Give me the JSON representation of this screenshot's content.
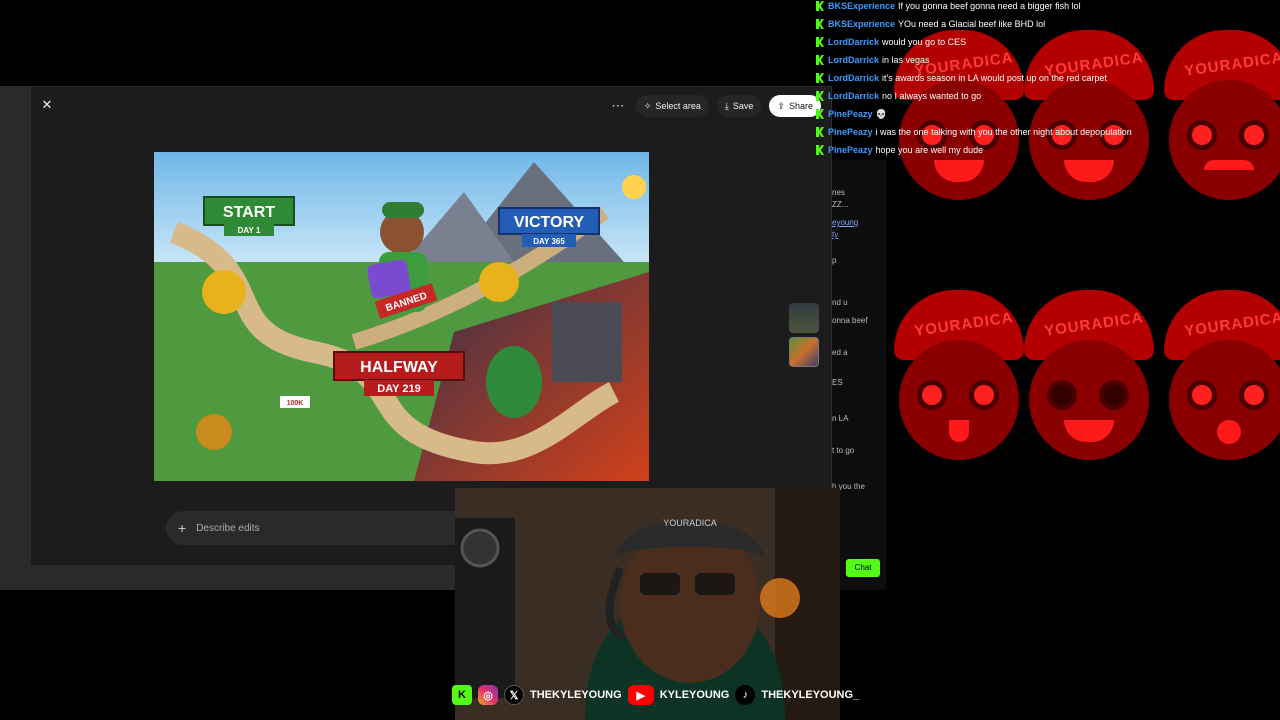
{
  "chat": {
    "messages": [
      {
        "user": "BKSExperience",
        "text": "If you gonna beef gonna need a bigger fish lol"
      },
      {
        "user": "BKSExperience",
        "text": "YOu need a Glacial beef like BHD lol"
      },
      {
        "user": "LordDarrick",
        "text": "would you go to CES"
      },
      {
        "user": "LordDarrick",
        "text": "in las vegas"
      },
      {
        "user": "LordDarrick",
        "text": "it's awards season in LA would post up on the red carpet"
      },
      {
        "user": "LordDarrick",
        "text": "no I always wanted to go"
      },
      {
        "user": "PinePeazy",
        "text": "💀"
      },
      {
        "user": "PinePeazy",
        "text": "i was the one talking with you the other night about depopulation"
      },
      {
        "user": "PinePeazy",
        "text": "hope you are well my dude"
      }
    ],
    "panel_fragments": [
      "nes",
      "ZZ...",
      "eyoung",
      "ty",
      "p",
      "nd u",
      "onna beef",
      "ed a",
      "ES",
      "n LA",
      "t to go",
      "h you the",
      "e"
    ],
    "chat_button": "Chat",
    "user_color": "#3b9bff",
    "kick_color": "#53fc18"
  },
  "emote_wall": {
    "cap_text": "YOURADICA",
    "count": 6
  },
  "viewer": {
    "close_icon": "close-icon",
    "more_icon": "more-horizontal-icon",
    "select_area_label": "Select area",
    "save_label": "Save",
    "share_label": "Share",
    "describe_placeholder": "Describe edits",
    "image": {
      "start_title": "START",
      "start_sub": "DAY 1",
      "victory_title": "VICTORY",
      "victory_sub": "DAY 365",
      "halfway_title": "HALFWAY",
      "halfway_sub": "DAY 219",
      "banned_label": "BANNED",
      "subs_label": "100K"
    }
  },
  "socials": {
    "x_handle": "THEKYLEYOUNG",
    "youtube_handle": "KYLEYOUNG",
    "tiktok_handle": "THEKYLEYOUNG_"
  },
  "webcam": {
    "hat_text": "YOURADICA"
  }
}
